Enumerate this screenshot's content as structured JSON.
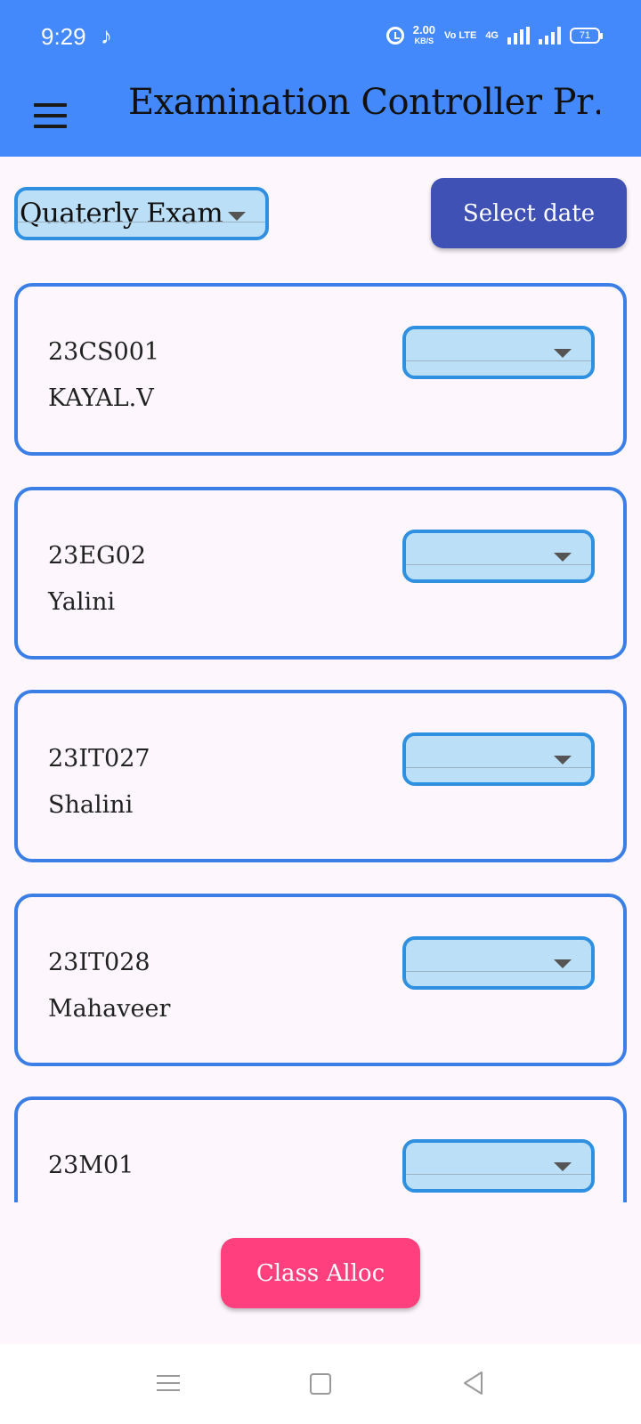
{
  "status_bar": {
    "time": "9:29",
    "net_speed": "2.00",
    "net_speed_unit": "KB/S",
    "volte": "Vo LTE",
    "network": "4G",
    "battery": "71"
  },
  "app_bar": {
    "title": "Examination Controller Pr…"
  },
  "filters": {
    "exam_selected": "Quaterly Exam",
    "date_button_label": "Select date"
  },
  "students": [
    {
      "id": "23CS001",
      "name": "KAYAL.V"
    },
    {
      "id": "23EG02",
      "name": "Yalini"
    },
    {
      "id": "23IT027",
      "name": "Shalini"
    },
    {
      "id": "23IT028",
      "name": "Mahaveer"
    },
    {
      "id": "23M01",
      "name": ""
    }
  ],
  "actions": {
    "class_alloc_label": "Class Alloc"
  },
  "colors": {
    "primary": "#4489fb",
    "indigo_button": "#3f51b5",
    "pink_button": "#ff3f7e",
    "dropdown_fill": "#bcdff8",
    "dropdown_border": "#2f8fe0",
    "card_border": "#3b7fe6",
    "background": "#fdf7fd"
  },
  "icons": {
    "menu": "hamburger-menu-icon",
    "dropdown": "triangle-down-icon",
    "nav_recents": "nav-menu-icon",
    "nav_home": "square-home-icon",
    "nav_back": "triangle-back-icon"
  }
}
